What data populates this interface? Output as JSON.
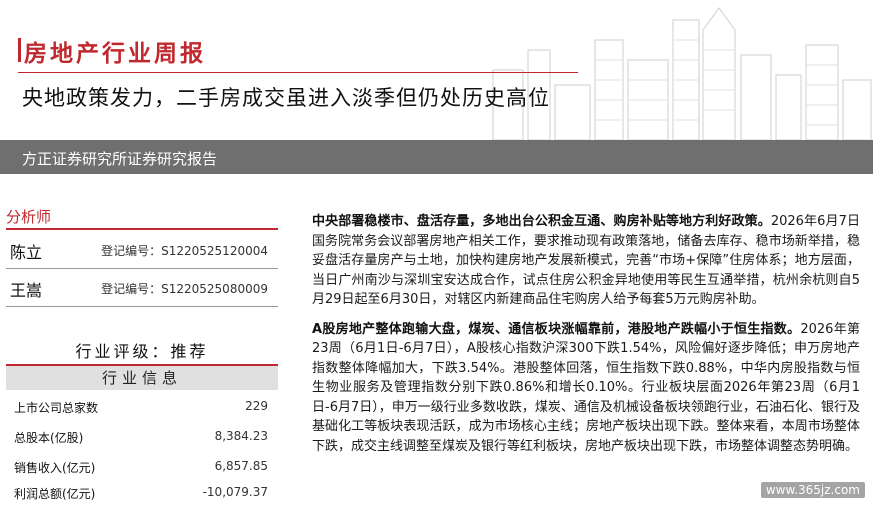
{
  "header": {
    "report_type": "房地产行业周报",
    "title": "央地政策发力，二手房成交虽进入淡季但仍处历史高位",
    "institution": "方正证券研究所证券研究报告"
  },
  "analysts": {
    "section_title": "分析师",
    "list": [
      {
        "name": "陈立",
        "reg": "登记编号：S1220525120004"
      },
      {
        "name": "王嵩",
        "reg": "登记编号：S1220525080009"
      }
    ]
  },
  "rating": {
    "text": "行业评级：推荐"
  },
  "industry_info": {
    "title": "行业信息",
    "rows": [
      {
        "label": "上市公司总家数",
        "value": "229"
      },
      {
        "label": "总股本(亿股)",
        "value": "8,384.23"
      },
      {
        "label": "销售收入(亿元)",
        "value": "6,857.85"
      },
      {
        "label": "利润总额(亿元)",
        "value": "-10,079.37"
      }
    ]
  },
  "body": {
    "p1_bold": "中央部署稳楼市、盘活存量，多地出台公积金互通、购房补贴等地方利好政策。",
    "p1_text": "2026年6月7日国务院常务会议部署房地产相关工作，要求推动现有政策落地，储备去库存、稳市场新举措，稳妥盘活存量房产与土地，加快构建房地产发展新模式，完善“市场+保障”住房体系；地方层面，当日广州南沙与深圳宝安达成合作，试点住房公积金异地使用等民生互通举措，杭州余杭则自5月29日起至6月30日，对辖区内新建商品住宅购房人给予每套5万元购房补助。",
    "p2_bold": "A股房地产整体跑输大盘，煤炭、通信板块涨幅靠前，港股地产跌幅小于恒生指数。",
    "p2_text": "2026年第23周（6月1日-6月7日），A股核心指数沪深300下跌1.54%，风险偏好逐步降低；申万房地产指数整体降幅加大，下跌3.54%。港股整体回落，恒生指数下跌0.88%，中华内房股指数与恒生物业服务及管理指数分别下跌0.86%和增长0.10%。行业板块层面2026年第23周（6月1日-6月7日），申万一级行业多数收跌，煤炭、通信及机械设备板块领跑行业，石油石化、银行及基础化工等板块表现活跃，成为市场核心主线；房地产板块出现下跌。整体来看，本周市场整体下跌，成交主线调整至煤炭及银行等红利板块，房地产板块出现下跌，市场整体调整态势明确。"
  },
  "watermark": {
    "text": "www.365jz.com"
  },
  "colors": {
    "accent": "#c0282d",
    "band": "#6f6f6f",
    "info_header_bg": "#e0e0e0"
  }
}
